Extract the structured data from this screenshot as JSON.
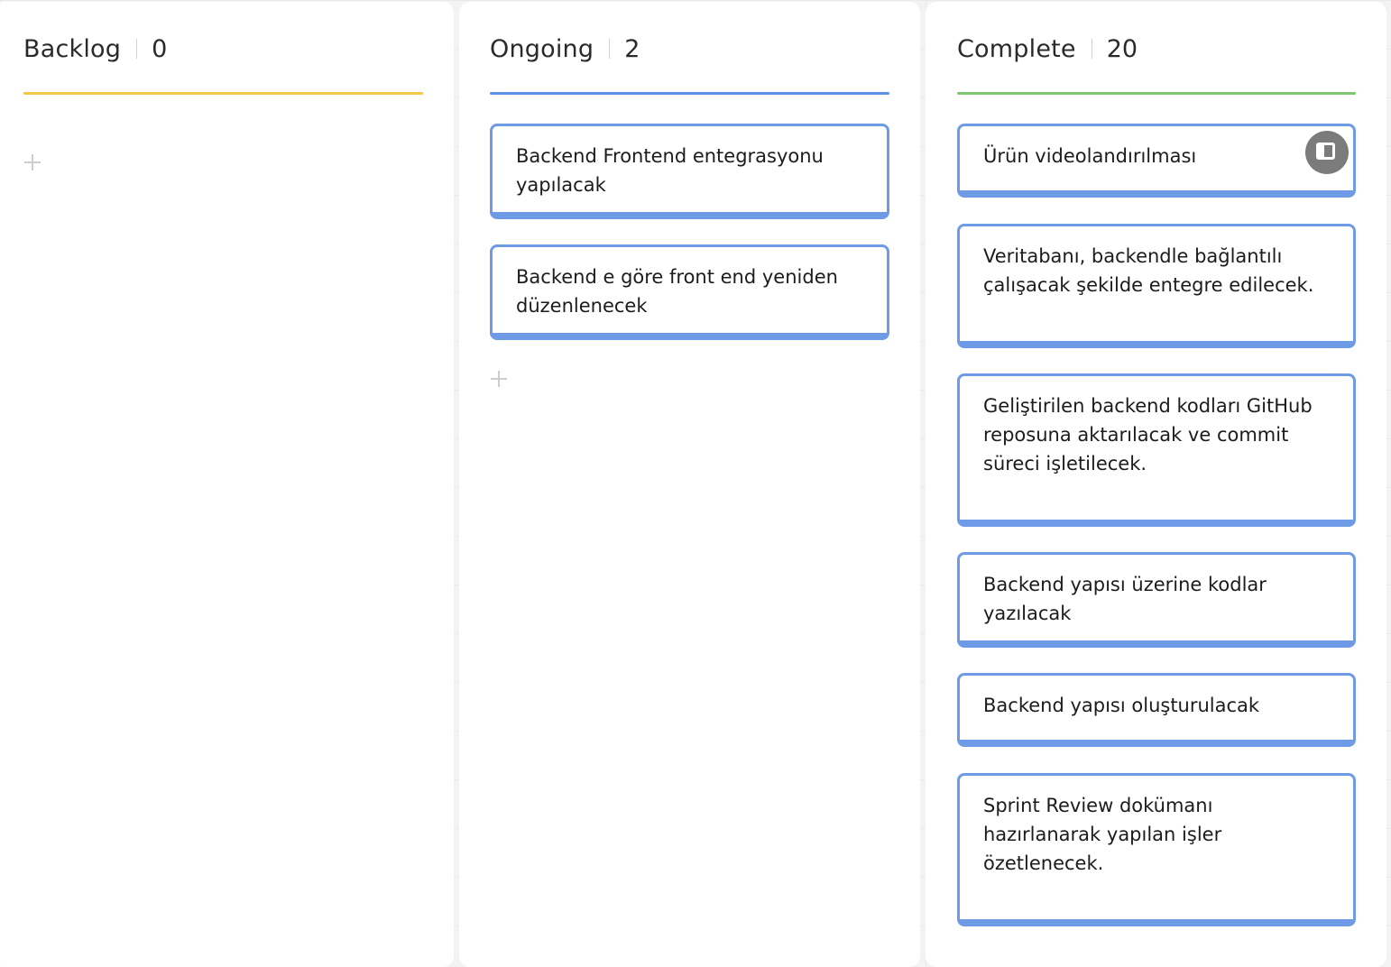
{
  "board": {
    "columns": [
      {
        "title": "Backlog",
        "count": "0",
        "color": "#f3c94a",
        "cards": []
      },
      {
        "title": "Ongoing",
        "count": "2",
        "color": "#5b93e4",
        "cards": [
          {
            "text": "Backend Frontend entegrasyonu yapılacak"
          },
          {
            "text": "Backend e göre front end yeniden düzenlenecek"
          }
        ]
      },
      {
        "title": "Complete",
        "count": "20",
        "color": "#7ec66f",
        "cards": [
          {
            "text": "Ürün videolandırılması",
            "action_icon": "expand-panel-icon"
          },
          {
            "text": "Veritabanı, backendle bağlantılı çalışacak şekilde entegre edilecek."
          },
          {
            "text": "Geliştirilen backend kodları GitHub reposuna aktarılacak ve commit süreci işletilecek."
          },
          {
            "text": "Backend yapısı üzerine kodlar yazılacak"
          },
          {
            "text": "Backend yapısı oluşturulacak"
          },
          {
            "text": "Sprint Review dokümanı hazırlanarak yapılan işler özetlenecek."
          }
        ]
      }
    ],
    "card_border_color": "#6f9ae6",
    "add_icon": "plus-icon"
  }
}
